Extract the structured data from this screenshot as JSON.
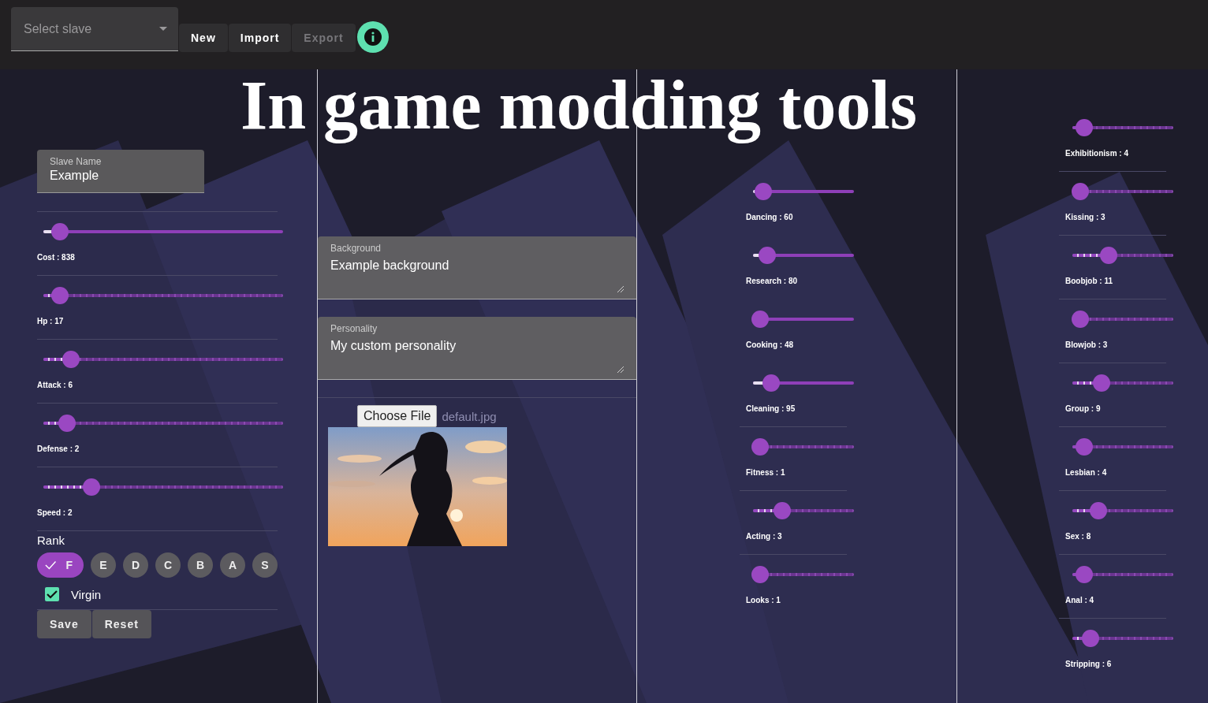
{
  "toolbar": {
    "slave_select": {
      "placeholder": "Select slave"
    },
    "buttons": [
      {
        "label": "New",
        "disabled": false
      },
      {
        "label": "Import",
        "disabled": false
      },
      {
        "label": "Export",
        "disabled": true
      }
    ]
  },
  "title": "In game modding tools",
  "stats_column": {
    "name_field": {
      "label": "Slave Name",
      "value": "Example"
    },
    "sliders": [
      {
        "label": "Cost : 838",
        "kind": "continuous",
        "level": 0.07
      },
      {
        "label": "Hp : 17",
        "kind": "stepped",
        "level": 0.07
      },
      {
        "label": "Attack : 6",
        "kind": "stepped",
        "level": 0.116
      },
      {
        "label": "Defense : 2",
        "kind": "stepped",
        "level": 0.1
      },
      {
        "label": "Speed : 2",
        "kind": "stepped",
        "level": 0.2
      }
    ],
    "rank": {
      "label": "Rank",
      "options": [
        {
          "label": "F",
          "selected": true
        },
        {
          "label": "E",
          "selected": false
        },
        {
          "label": "D",
          "selected": false
        },
        {
          "label": "C",
          "selected": false
        },
        {
          "label": "B",
          "selected": false
        },
        {
          "label": "A",
          "selected": false
        },
        {
          "label": "S",
          "selected": false
        }
      ]
    },
    "virgin": {
      "label": "Virgin",
      "checked": true
    },
    "buttons": [
      "Save",
      "Reset"
    ]
  },
  "text_column": {
    "fields": [
      {
        "label": "Background",
        "value": "Example background"
      },
      {
        "label": "Personality",
        "value": "My custom personality"
      }
    ],
    "file": {
      "button": "Choose File",
      "file_name": "default.jpg"
    }
  },
  "skills_column": {
    "sliders": [
      {
        "label": "Dancing : 60",
        "kind": "continuous",
        "level": 0.1,
        "divider": false
      },
      {
        "label": "Research : 80",
        "kind": "continuous",
        "level": 0.14,
        "divider": false
      },
      {
        "label": "Cooking : 48",
        "kind": "continuous",
        "level": 0.07,
        "divider": false
      },
      {
        "label": "Cleaning : 95",
        "kind": "continuous",
        "level": 0.18,
        "divider": false
      },
      {
        "label": "Fitness : 1",
        "kind": "stepped",
        "level": 0.07,
        "divider": true
      },
      {
        "label": "Acting : 3",
        "kind": "stepped",
        "level": 0.29,
        "divider": true
      },
      {
        "label": "Looks : 1",
        "kind": "stepped",
        "level": 0.07,
        "divider": true
      }
    ]
  },
  "traits_column": {
    "sliders": [
      {
        "label": "Exhibitionism : 4",
        "kind": "stepped",
        "level": 0.12,
        "divider": false
      },
      {
        "label": "Kissing : 3",
        "kind": "stepped",
        "level": 0.08,
        "divider": true
      },
      {
        "label": "Boobjob : 11",
        "kind": "stepped",
        "level": 0.36,
        "divider": true
      },
      {
        "label": "Blowjob : 3",
        "kind": "stepped",
        "level": 0.08,
        "divider": true
      },
      {
        "label": "Group : 9",
        "kind": "stepped",
        "level": 0.29,
        "divider": true
      },
      {
        "label": "Lesbian : 4",
        "kind": "stepped",
        "level": 0.12,
        "divider": true
      },
      {
        "label": "Sex : 8",
        "kind": "stepped",
        "level": 0.26,
        "divider": true
      },
      {
        "label": "Anal : 4",
        "kind": "stepped",
        "level": 0.12,
        "divider": true
      },
      {
        "label": "Stripping : 6",
        "kind": "stepped",
        "level": 0.18,
        "divider": true
      }
    ]
  }
}
